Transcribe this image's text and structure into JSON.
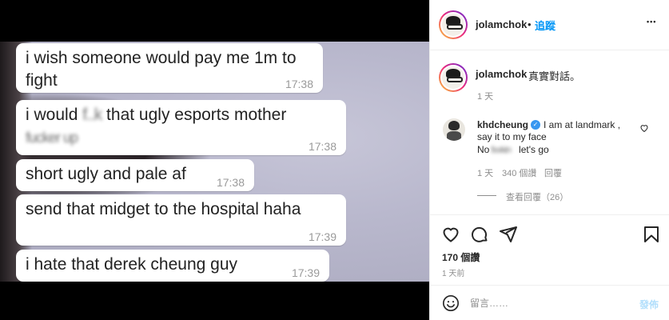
{
  "media": {
    "messages": [
      {
        "parts": [
          "i wish someone would pay me 1m to fight"
        ],
        "time": "17:38"
      },
      {
        "line1_pre": "i would ",
        "line1_blur": "f..k",
        "line1_post": " that ugly esports mother",
        "line2_blur": "fucker up",
        "time": "17:38"
      },
      {
        "text": "short ugly and pale af",
        "time": "17:38"
      },
      {
        "text": "send that midget to the hospital haha",
        "time": "17:39"
      },
      {
        "text": "i hate that derek cheung guy",
        "time": "17:39"
      }
    ]
  },
  "post": {
    "author": "jolamchok",
    "separator": "•",
    "follow_label": "追蹤",
    "more_label": "•••",
    "caption": "真實對話。",
    "caption_age": "1 天",
    "comment": {
      "author": "khdcheung",
      "line1": "I am at landmark ,",
      "line2": "say it to my face",
      "line3_pre": "No",
      "line3_blur": "fxxkin",
      "line3_post": "let's go",
      "age": "1 天",
      "likes": "340 個讚",
      "reply_label": "回覆",
      "view_replies": "查看回覆（26）"
    },
    "likes": "170 個讚",
    "posted_ago": "1 天前",
    "composer": {
      "placeholder": "留言……",
      "post_label": "發佈"
    }
  },
  "icons": [
    "heart-icon",
    "comment-icon",
    "share-icon",
    "bookmark-icon",
    "emoji-icon",
    "verified-icon",
    "more-icon"
  ],
  "colors": {
    "accent": "#0095f6",
    "verified": "#3897f0",
    "post_disabled": "#b2dffc",
    "meta": "#8e8e8e"
  }
}
